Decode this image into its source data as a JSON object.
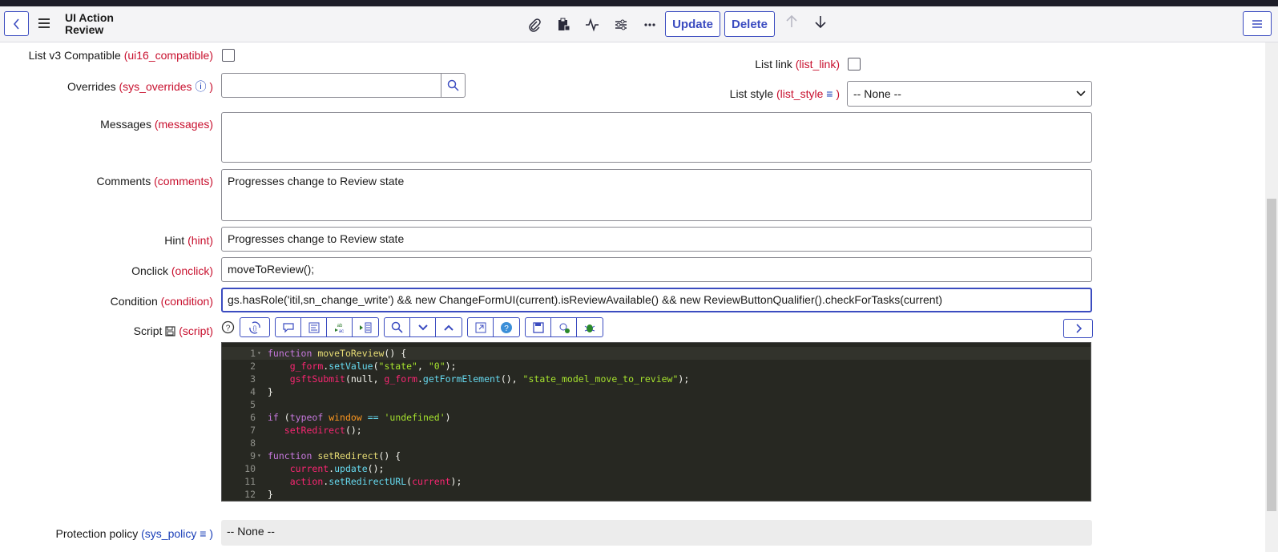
{
  "header": {
    "title": "UI Action Review",
    "update_label": "Update",
    "delete_label": "Delete"
  },
  "fields": {
    "ui16": {
      "label": "List v3 Compatible",
      "field": "(ui16_compatible)"
    },
    "list_link": {
      "label": "List link",
      "field": "(list_link)"
    },
    "overrides": {
      "label": "Overrides",
      "field_open": "(sys_overrides",
      "field_close": ")",
      "value": ""
    },
    "list_style": {
      "label": "List style",
      "field_open": "(list_style",
      "field_close": ")",
      "value": "-- None --"
    },
    "messages": {
      "label": "Messages",
      "field": "(messages)",
      "value": ""
    },
    "comments": {
      "label": "Comments",
      "field": "(comments)",
      "value": "Progresses change to Review state"
    },
    "hint": {
      "label": "Hint",
      "field": "(hint)",
      "value": "Progresses change to Review state"
    },
    "onclick": {
      "label": "Onclick",
      "field": "(onclick)",
      "value": "moveToReview();"
    },
    "condition": {
      "label": "Condition",
      "field": "(condition)",
      "value": "gs.hasRole('itil,sn_change_write') && new ChangeFormUI(current).isReviewAvailable() && new ReviewButtonQualifier().checkForTasks(current)"
    },
    "script": {
      "label": "Script",
      "field": "(script)"
    },
    "protection": {
      "label": "Protection policy",
      "field_open": "(sys_policy",
      "field_close": ")",
      "value": "-- None --"
    }
  },
  "code": {
    "line_numbers": [
      "1",
      "2",
      "3",
      "4",
      "5",
      "6",
      "7",
      "8",
      "9",
      "10",
      "11",
      "12"
    ]
  },
  "colors": {
    "accent": "#3b4cc0",
    "field_name": "#c8102e",
    "editor_bg": "#272822"
  }
}
